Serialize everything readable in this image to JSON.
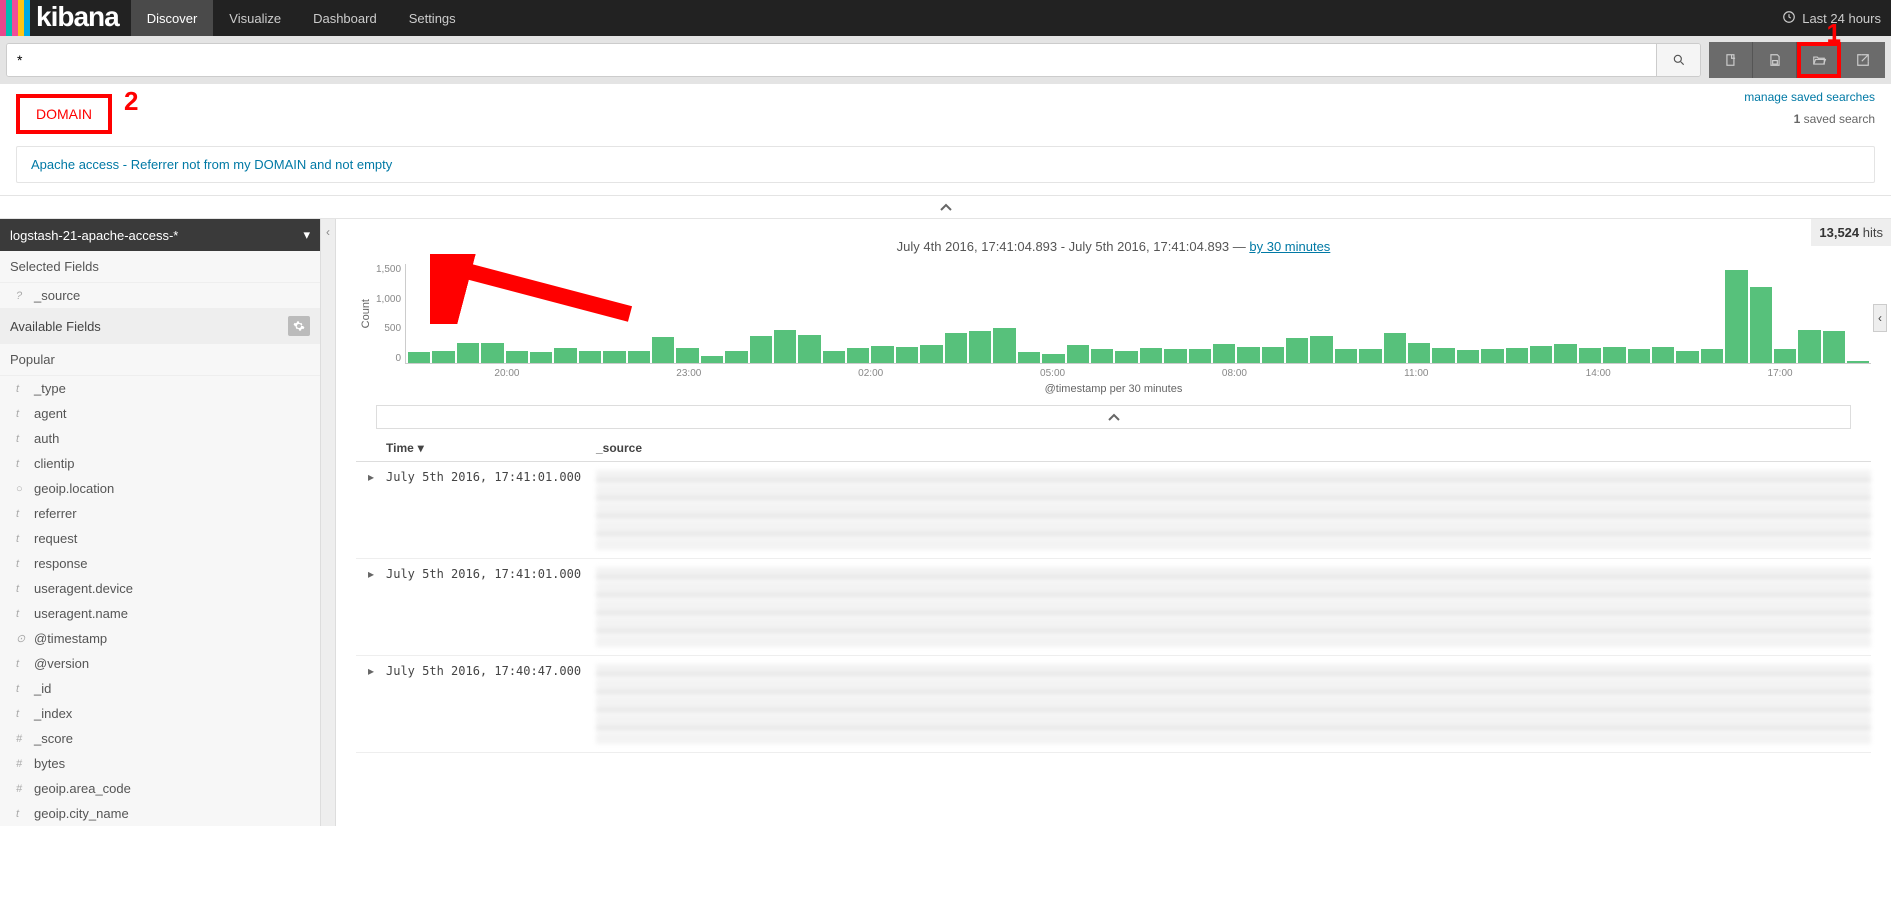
{
  "brand": "kibana",
  "nav": {
    "tabs": [
      "Discover",
      "Visualize",
      "Dashboard",
      "Settings"
    ],
    "active": "Discover",
    "time_label": "Last 24 hours"
  },
  "query": {
    "value": "*"
  },
  "saved_panel": {
    "manage_link": "manage saved searches",
    "filter_text": "DOMAIN",
    "count_text": "saved search",
    "count_num": "1",
    "result": "Apache access - Referrer not from my DOMAIN and not empty"
  },
  "annotations": {
    "one": "1",
    "two": "2"
  },
  "sidebar": {
    "index_pattern": "logstash-21-apache-access-*",
    "selected_header": "Selected Fields",
    "selected": [
      {
        "type": "?",
        "name": "_source"
      }
    ],
    "available_header": "Available Fields",
    "popular_header": "Popular",
    "popular": [
      {
        "type": "t",
        "name": "_type"
      },
      {
        "type": "t",
        "name": "agent"
      },
      {
        "type": "t",
        "name": "auth"
      },
      {
        "type": "t",
        "name": "clientip"
      },
      {
        "type": "○",
        "name": "geoip.location"
      },
      {
        "type": "t",
        "name": "referrer"
      },
      {
        "type": "t",
        "name": "request"
      },
      {
        "type": "t",
        "name": "response"
      },
      {
        "type": "t",
        "name": "useragent.device"
      },
      {
        "type": "t",
        "name": "useragent.name"
      },
      {
        "type": "⊙",
        "name": "@timestamp"
      },
      {
        "type": "t",
        "name": "@version"
      },
      {
        "type": "t",
        "name": "_id"
      },
      {
        "type": "t",
        "name": "_index"
      },
      {
        "type": "#",
        "name": "_score"
      },
      {
        "type": "#",
        "name": "bytes"
      },
      {
        "type": "#",
        "name": "geoip.area_code"
      },
      {
        "type": "t",
        "name": "geoip.city_name"
      }
    ]
  },
  "hits": {
    "count": "13,524",
    "label": "hits"
  },
  "timerange": {
    "text": "July 4th 2016, 17:41:04.893 - July 5th 2016, 17:41:04.893 — ",
    "interval": "by 30 minutes"
  },
  "chart_data": {
    "type": "bar",
    "ylabel": "Count",
    "xlabel": "@timestamp per 30 minutes",
    "y_ticks": [
      "1,500",
      "1,000",
      "500",
      "0"
    ],
    "x_ticks": [
      "20:00",
      "23:00",
      "02:00",
      "05:00",
      "08:00",
      "11:00",
      "14:00",
      "17:00"
    ],
    "ylim": [
      0,
      1600
    ],
    "values": [
      170,
      200,
      320,
      330,
      190,
      180,
      250,
      200,
      200,
      190,
      420,
      250,
      120,
      190,
      430,
      530,
      460,
      200,
      240,
      280,
      260,
      290,
      480,
      510,
      560,
      180,
      150,
      290,
      230,
      200,
      240,
      220,
      230,
      300,
      260,
      260,
      410,
      430,
      220,
      230,
      480,
      330,
      240,
      210,
      230,
      240,
      270,
      300,
      250,
      260,
      220,
      260,
      200,
      230,
      1500,
      1230,
      230,
      530,
      520,
      30
    ]
  },
  "docs": {
    "col_time": "Time",
    "col_source": "_source",
    "rows": [
      {
        "time": "July 5th 2016, 17:41:01.000"
      },
      {
        "time": "July 5th 2016, 17:41:01.000"
      },
      {
        "time": "July 5th 2016, 17:40:47.000"
      }
    ]
  }
}
